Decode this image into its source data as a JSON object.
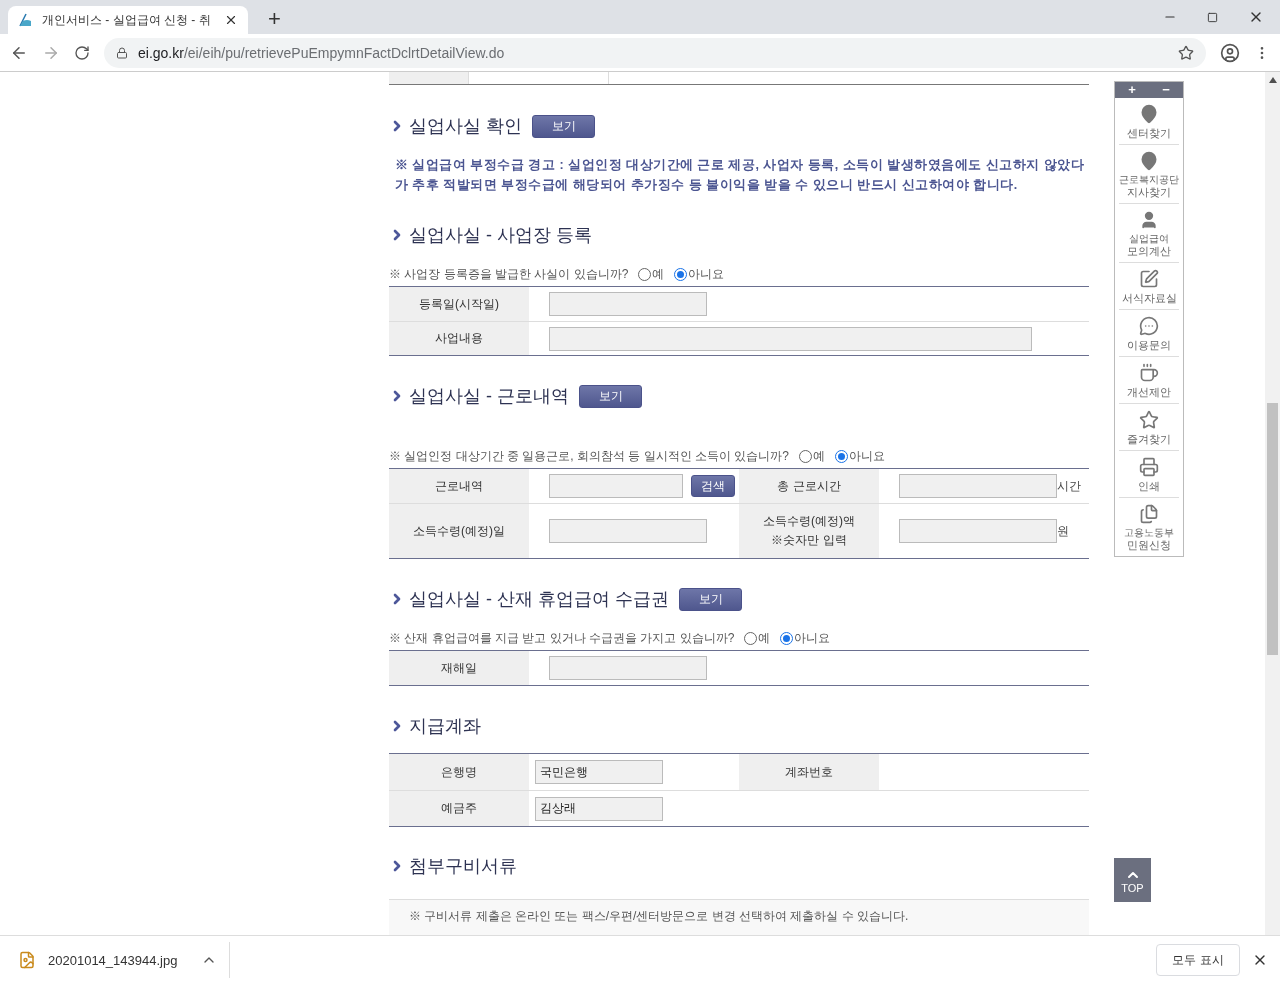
{
  "browser": {
    "tab_title": "개인서비스 - 실업급여 신청 - 취",
    "new_tab": "+",
    "url_host": "ei.go.kr",
    "url_path": "/ei/eih/pu/retrievePuEmpymnFactDclrtDetailView.do"
  },
  "sections": [
    {
      "title": "실업사실 확인",
      "button": "보기",
      "warning": "※ 실업급여 부정수급 경고 : 실업인정 대상기간에 근로 제공, 사업자 등록, 소득이 발생하였음에도 신고하지 않았다가 추후 적발되면 부정수급에 해당되어 추가징수 등 불이익을 받을 수 있으니 반드시 신고하여야 합니다."
    },
    {
      "title": "실업사실 - 사업장 등록",
      "question": "※ 사업장 등록증을 발급한 사실이 있습니까?",
      "options": [
        {
          "label": "예",
          "selected": false
        },
        {
          "label": "아니요",
          "selected": true
        }
      ],
      "rows": [
        [
          {
            "kind": "label",
            "text": "등록일(시작일)"
          },
          {
            "kind": "field"
          }
        ],
        [
          {
            "kind": "label",
            "text": "사업내용"
          },
          {
            "kind": "wide_field"
          }
        ]
      ]
    },
    {
      "title": "실업사실 - 근로내역",
      "button": "보기",
      "question": "※ 실업인정 대상기간 중 일용근로, 회의참석 등 일시적인 소득이 있습니까?",
      "options": [
        {
          "label": "예",
          "selected": false
        },
        {
          "label": "아니요",
          "selected": true
        }
      ],
      "rows": [
        [
          {
            "kind": "label",
            "text": "근로내역"
          },
          {
            "kind": "search_field",
            "button": "검색"
          },
          {
            "kind": "label",
            "text": "총 근로시간"
          },
          {
            "kind": "field",
            "unit": "시간"
          }
        ],
        [
          {
            "kind": "label",
            "text": "소득수령(예정)일"
          },
          {
            "kind": "field"
          },
          {
            "kind": "label",
            "text": "소득수령(예정)액",
            "note": "※숫자만 입력"
          },
          {
            "kind": "field",
            "unit": "원"
          }
        ]
      ]
    },
    {
      "title": "실업사실 - 산재 휴업급여 수급권",
      "button": "보기",
      "question": "※ 산재 휴업급여를 지급 받고 있거나 수급권을 가지고 있습니까?",
      "options": [
        {
          "label": "예",
          "selected": false
        },
        {
          "label": "아니요",
          "selected": true
        }
      ],
      "rows": [
        [
          {
            "kind": "label",
            "text": "재해일"
          },
          {
            "kind": "field"
          }
        ]
      ]
    },
    {
      "title": "지급계좌",
      "rows": [
        [
          {
            "kind": "label",
            "text": "은행명"
          },
          {
            "kind": "value_field",
            "value": "국민은행"
          },
          {
            "kind": "label",
            "text": "계좌번호"
          },
          {
            "kind": "empty"
          }
        ],
        [
          {
            "kind": "label",
            "text": "예금주"
          },
          {
            "kind": "value_field",
            "value": "김상래"
          }
        ]
      ]
    },
    {
      "title": "첨부구비서류",
      "notice": "※ 구비서류 제출은 온라인 또는 팩스/우편/센터방문으로 변경 선택하여 제출하실 수 있습니다."
    }
  ],
  "quick_menu": {
    "zoom_in": "+",
    "zoom_out": "−",
    "items": [
      {
        "label": "센터찾기"
      },
      {
        "label": "근로복지공단",
        "sub": "지사찾기"
      },
      {
        "label": "실업급여",
        "sub": "모의계산"
      },
      {
        "label": "서식자료실"
      },
      {
        "label": "이용문의"
      },
      {
        "label": "개선제안"
      },
      {
        "label": "즐겨찾기"
      },
      {
        "label": "인쇄"
      },
      {
        "label": "고용노동부",
        "sub": "민원신청"
      }
    ]
  },
  "top_button": "TOP",
  "download_bar": {
    "file": "20201014_143944.jpg",
    "show_all": "모두 표시"
  }
}
